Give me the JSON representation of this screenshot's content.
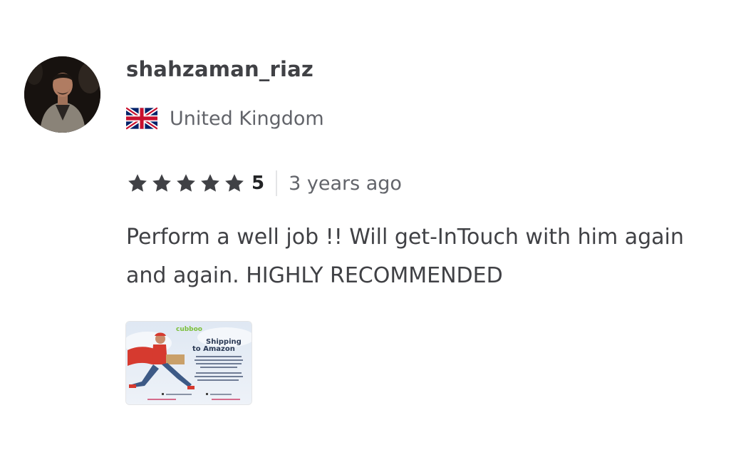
{
  "review": {
    "username": "shahzaman_riaz",
    "country": "United Kingdom",
    "flag_icon": "uk-flag-icon",
    "rating": "5",
    "star_count": 5,
    "star_color": "#404145",
    "time_ago": "3 years ago",
    "text": "Perform a well job !! Will get-InTouch with him again and again. HIGHLY RECOMMENDED",
    "attachment": {
      "logo_text": "cubboo",
      "headline_line1": "Shipping",
      "headline_line2": "to Amazon"
    }
  }
}
